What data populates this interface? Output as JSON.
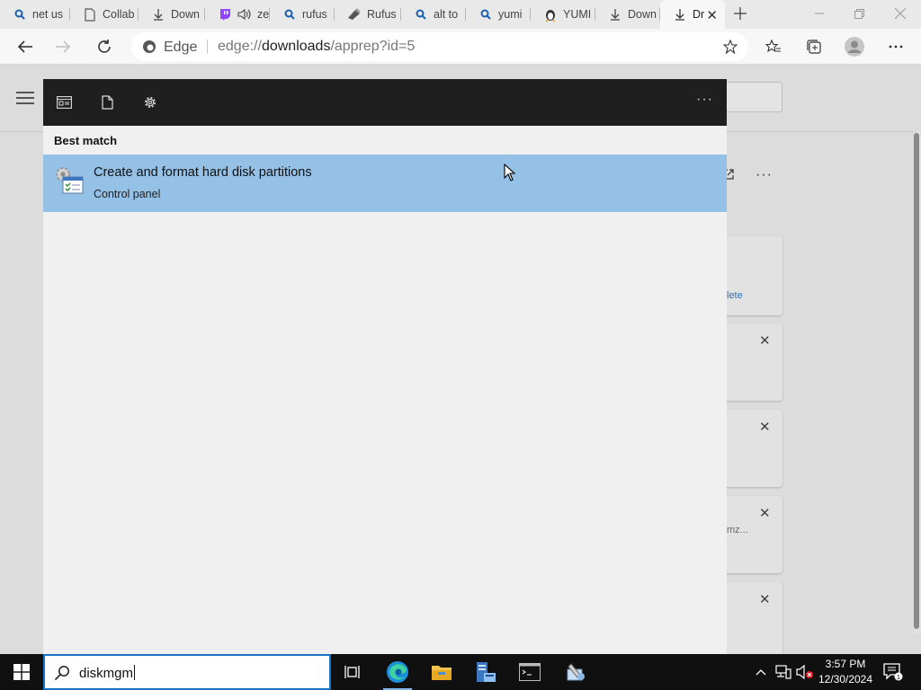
{
  "browser": {
    "tabs": [
      {
        "title": "net us",
        "icon": "search-icon"
      },
      {
        "title": "Collab",
        "icon": "page-icon"
      },
      {
        "title": "Down",
        "icon": "download-icon"
      },
      {
        "title": "ze",
        "icon": "twitch-icon"
      },
      {
        "title": "rufus",
        "icon": "search-icon"
      },
      {
        "title": "Rufus",
        "icon": "rufus-icon"
      },
      {
        "title": "alt to",
        "icon": "search-icon"
      },
      {
        "title": "yumi",
        "icon": "search-icon"
      },
      {
        "title": "YUMI",
        "icon": "yumi-icon"
      },
      {
        "title": "Down",
        "icon": "download-icon"
      },
      {
        "title": "Dr",
        "icon": "download-icon",
        "active": true
      }
    ],
    "address": {
      "label": "Edge",
      "url_prefix": "edge://",
      "url_host": "downloads",
      "url_path": "/apprep?id=5"
    }
  },
  "downloads_page": {
    "card_partial_text": [
      "lete",
      "mz..."
    ]
  },
  "search_panel": {
    "section_label": "Best match",
    "result": {
      "title": "Create and format hard disk partitions",
      "subtitle": "Control panel",
      "icon": "disk-management-icon"
    }
  },
  "taskbar": {
    "search_query": "diskmgm",
    "pinned_apps": [
      "task-view-icon",
      "edge-icon",
      "file-explorer-icon",
      "server-manager-icon",
      "command-prompt-icon",
      "tools-icon"
    ],
    "clock_time": "3:57 PM",
    "clock_date": "12/30/2024"
  },
  "colors": {
    "panel_header": "#1f1f1f",
    "result_highlight": "#95c1e6",
    "taskbar": "#101010",
    "search_border": "#1a73c9"
  }
}
